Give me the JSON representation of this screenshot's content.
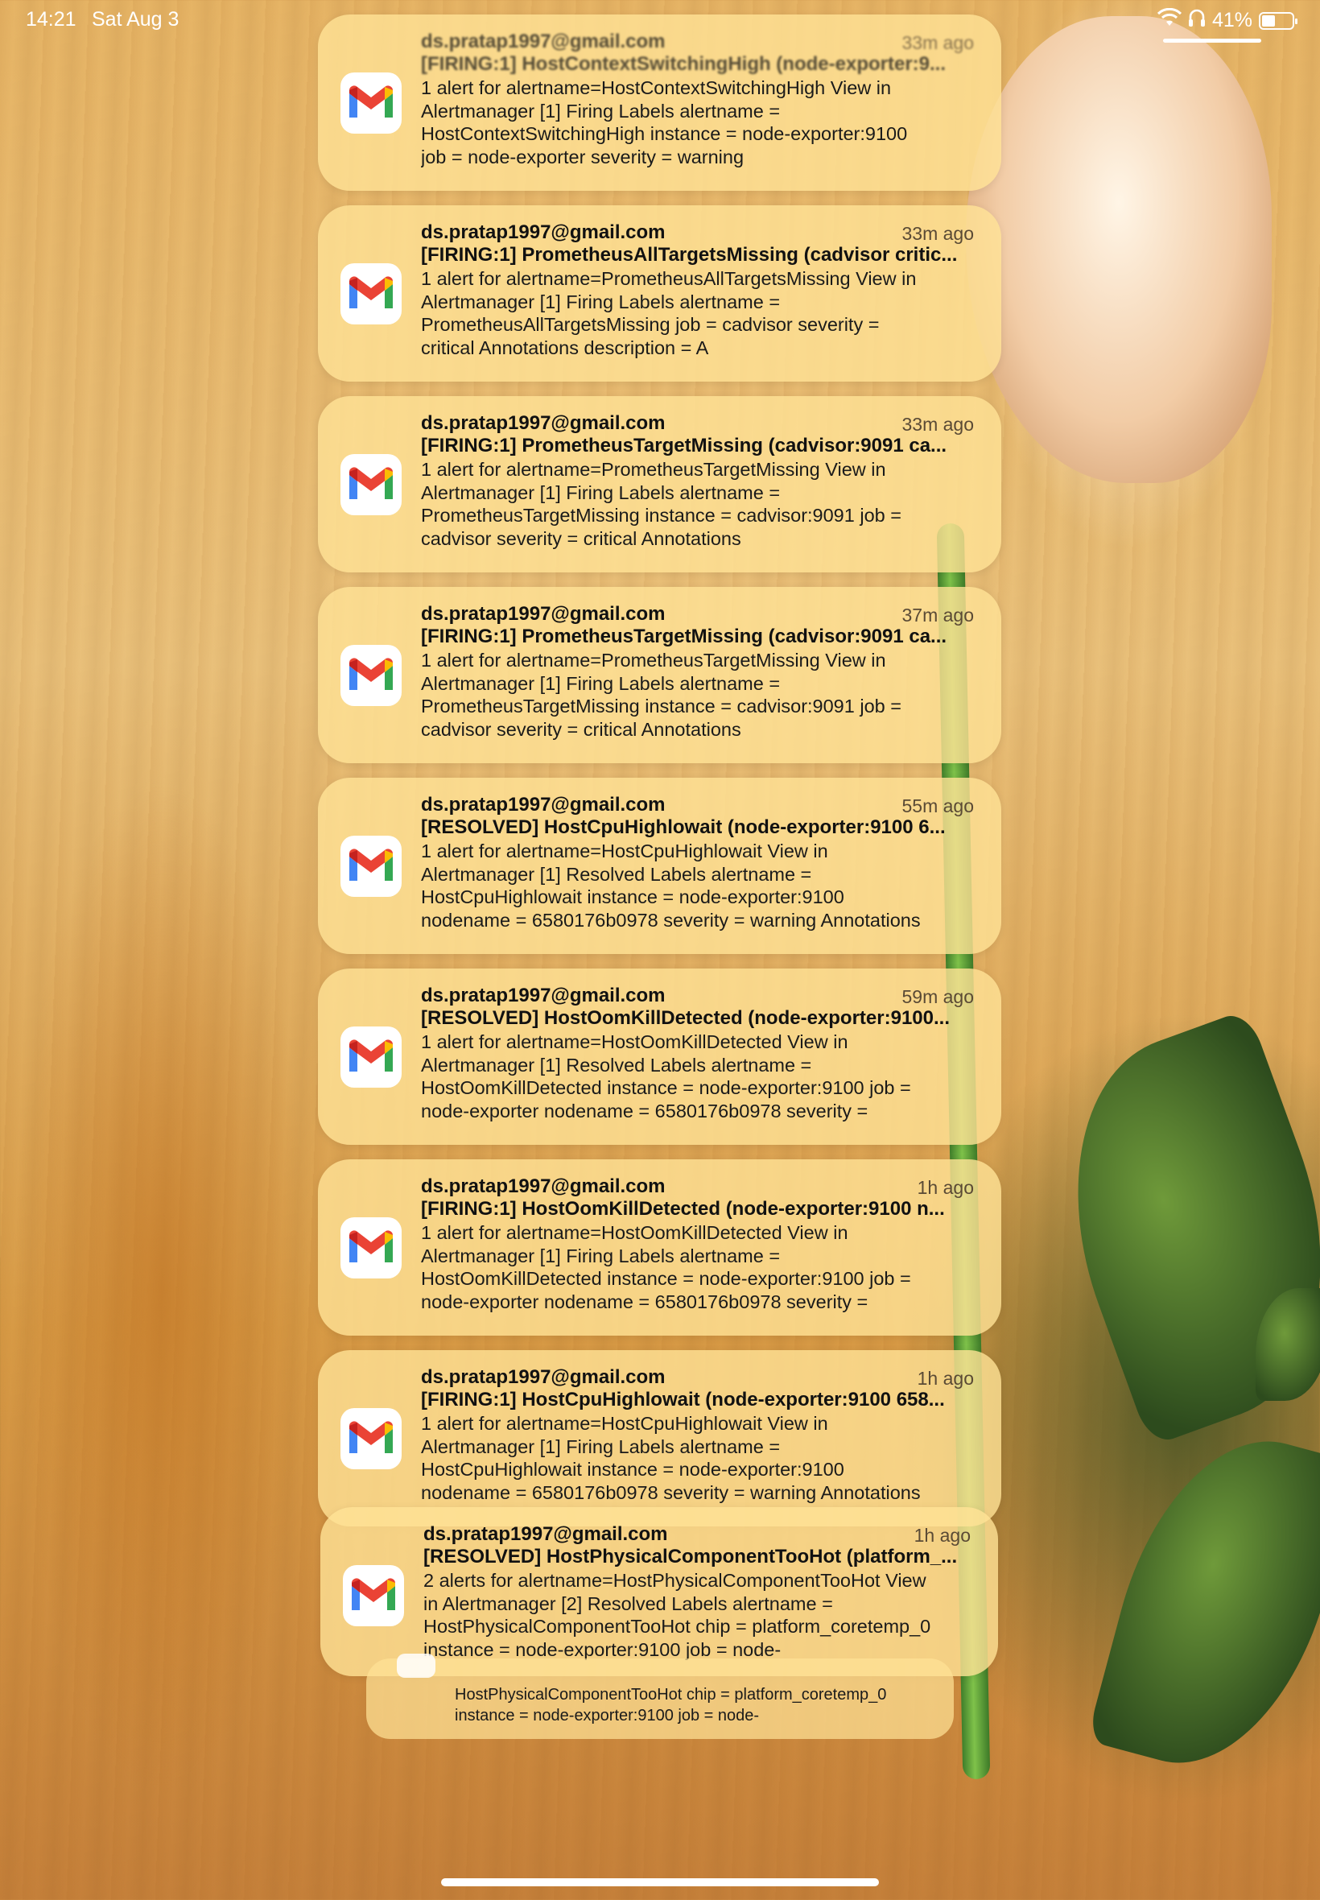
{
  "status_bar": {
    "time": "14:21",
    "date": "Sat Aug 3",
    "battery": "41%",
    "battery_level": 0.41
  },
  "notifications": [
    {
      "sender": "ds.pratap1997@gmail.com",
      "time": "33m ago",
      "subject": "[FIRING:1] HostContextSwitchingHigh (node-exporter:9...",
      "body": "1 alert for alertname=HostContextSwitchingHigh View in\nAlertmanager [1] Firing Labels alertname =\nHostContextSwitchingHigh instance = node-exporter:9100\njob = node-exporter severity = warning"
    },
    {
      "sender": "ds.pratap1997@gmail.com",
      "time": "33m ago",
      "subject": "[FIRING:1] PrometheusAllTargetsMissing (cadvisor critic...",
      "body": "1 alert for alertname=PrometheusAllTargetsMissing View in\nAlertmanager [1] Firing Labels alertname =\nPrometheusAllTargetsMissing job = cadvisor severity =\ncritical Annotations description = A"
    },
    {
      "sender": "ds.pratap1997@gmail.com",
      "time": "33m ago",
      "subject": "[FIRING:1] PrometheusTargetMissing (cadvisor:9091 ca...",
      "body": "1 alert for alertname=PrometheusTargetMissing View in\nAlertmanager [1] Firing Labels alertname =\nPrometheusTargetMissing instance = cadvisor:9091 job =\ncadvisor severity = critical Annotations"
    },
    {
      "sender": "ds.pratap1997@gmail.com",
      "time": "37m ago",
      "subject": "[FIRING:1] PrometheusTargetMissing (cadvisor:9091 ca...",
      "body": "1 alert for alertname=PrometheusTargetMissing View in\nAlertmanager [1] Firing Labels alertname =\nPrometheusTargetMissing instance = cadvisor:9091 job =\ncadvisor severity = critical Annotations"
    },
    {
      "sender": "ds.pratap1997@gmail.com",
      "time": "55m ago",
      "subject": "[RESOLVED] HostCpuHighlowait (node-exporter:9100 6...",
      "body": "1 alert for alertname=HostCpuHighlowait View in\nAlertmanager [1] Resolved Labels alertname =\nHostCpuHighlowait instance = node-exporter:9100\nnodename = 6580176b0978 severity = warning Annotations"
    },
    {
      "sender": "ds.pratap1997@gmail.com",
      "time": "59m ago",
      "subject": "[RESOLVED] HostOomKillDetected (node-exporter:9100...",
      "body": "1 alert for alertname=HostOomKillDetected View in\nAlertmanager [1] Resolved Labels alertname =\nHostOomKillDetected instance = node-exporter:9100 job =\nnode-exporter nodename = 6580176b0978 severity ="
    },
    {
      "sender": "ds.pratap1997@gmail.com",
      "time": "1h ago",
      "subject": "[FIRING:1] HostOomKillDetected (node-exporter:9100 n...",
      "body": "1 alert for alertname=HostOomKillDetected View in\nAlertmanager [1] Firing Labels alertname =\nHostOomKillDetected instance = node-exporter:9100 job =\nnode-exporter nodename = 6580176b0978 severity ="
    },
    {
      "sender": "ds.pratap1997@gmail.com",
      "time": "1h ago",
      "subject": "[FIRING:1] HostCpuHighlowait (node-exporter:9100 658...",
      "body": "1 alert for alertname=HostCpuHighlowait View in\nAlertmanager [1] Firing Labels alertname =\nHostCpuHighlowait instance = node-exporter:9100\nnodename = 6580176b0978 severity = warning Annotations"
    },
    {
      "sender": "ds.pratap1997@gmail.com",
      "time": "1h ago",
      "subject": "[RESOLVED] HostPhysicalComponentTooHot (platform_...",
      "body": "2 alerts for alertname=HostPhysicalComponentTooHot View\nin Alertmanager [2] Resolved Labels alertname =\nHostPhysicalComponentTooHot chip = platform_coretemp_0\ninstance = node-exporter:9100 job = node-"
    }
  ],
  "stacked_behind": {
    "body": "HostPhysicalComponentTooHot chip = platform_coretemp_0\ninstance = node-exporter:9100 job = node-"
  },
  "colors": {
    "gmail_red": "#EA4335",
    "gmail_blue": "#4285F4",
    "gmail_green": "#34A853",
    "gmail_yellow": "#FBBC04"
  }
}
